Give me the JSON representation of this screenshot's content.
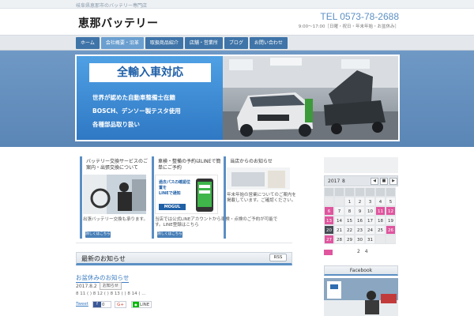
{
  "topbar": {
    "tagline": "岐阜県恵那市のバッテリー専門店"
  },
  "header": {
    "logo": "恵那バッテリー",
    "tel": "TEL 0573-78-2688",
    "hours": "9:00～17:00［日曜・祝日・年末年始・お盆休み］"
  },
  "nav": {
    "items": [
      {
        "label": "ホーム",
        "active": false
      },
      {
        "label": "会社概要・沿革",
        "active": true
      },
      {
        "label": "取扱商品紹介",
        "active": false
      },
      {
        "label": "店舗・営業所",
        "active": false
      },
      {
        "label": "ブログ",
        "active": false
      },
      {
        "label": "お問い合わせ",
        "active": false
      }
    ]
  },
  "hero": {
    "title": "全輸入車対応",
    "lines": [
      "世界が認めた自動車整備士在籍",
      "BOSCH、デンソー製テスタ使用",
      "各種部品取り扱い"
    ]
  },
  "cards": [
    {
      "title": "バッテリー交換サービスのご案内・出張交換について",
      "desc": "出張バッテリー交換も承ります。",
      "button": "詳しくはこちら"
    },
    {
      "title": "車検・整備の予約はLINEで簡単にご予約",
      "desc": "当店では公式LINEアカウントから車検・点検のご予約が可能です。LINE登録はこちら",
      "button": "詳しくはこちら",
      "thumb_lines": [
        "過去パスの確認位置を",
        "LINEで通知",
        "MOGUL"
      ]
    },
    {
      "title": "当店からのお知らせ",
      "desc": "年末年始の営業についてのご案内を掲載しています。ご確認ください。",
      "button": ""
    }
  ],
  "section": {
    "title": "最新のお知らせ",
    "rss": "RSS"
  },
  "post": {
    "title": "お盆休みのお知らせ",
    "date": "2017.8.2",
    "tag": "お知らせ",
    "excerpt": "8 11 ( ) 8 12 ( ) 8 13 ( ) 8 14 ( ...",
    "tweet": "Tweet",
    "fb_count": "0",
    "gplus": "G+",
    "line": "LINE"
  },
  "calendar": {
    "year": "2017",
    "month": "8",
    "controls": [
      "◀",
      "■",
      "▶"
    ],
    "weekday_heads": [
      "",
      "",
      "",
      "",
      "",
      "",
      ""
    ],
    "rows": [
      [
        "",
        "",
        "1",
        "2",
        "3",
        "4",
        "5"
      ],
      [
        "6",
        "7",
        "8",
        "9",
        "10",
        "11",
        "12"
      ],
      [
        "13",
        "14",
        "15",
        "16",
        "17",
        "18",
        "19"
      ],
      [
        "20",
        "21",
        "22",
        "23",
        "24",
        "25",
        "26"
      ],
      [
        "27",
        "28",
        "29",
        "30",
        "31",
        "",
        ""
      ]
    ],
    "holidays": [
      "6",
      "11",
      "12",
      "13",
      "20",
      "26",
      "27"
    ],
    "today": "20",
    "legend": "2 4"
  },
  "widget": {
    "title": "Facebook"
  },
  "colors": {
    "brand": "#3f74a8",
    "accent": "#5b8fc4",
    "holiday": "#e0559e"
  }
}
